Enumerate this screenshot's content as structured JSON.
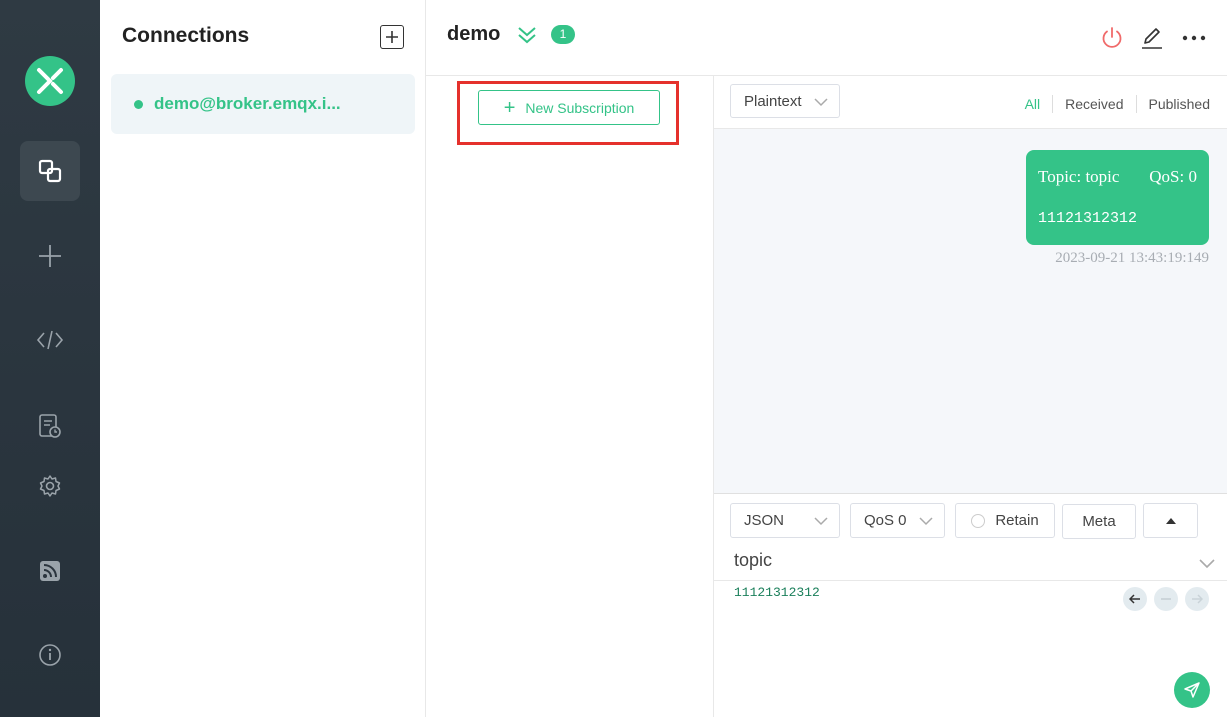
{
  "connections": {
    "title": "Connections",
    "items": [
      {
        "name": "demo@broker.emqx.i..."
      }
    ]
  },
  "header": {
    "title": "demo",
    "badge": "1"
  },
  "subscriptions": {
    "new_button_label": "New Subscription"
  },
  "messages": {
    "format_select": "Plaintext",
    "filters": {
      "all": "All",
      "received": "Received",
      "published": "Published",
      "active": "All"
    },
    "items": [
      {
        "topic": "Topic: topic",
        "qos": "QoS: 0",
        "payload": "11121312312",
        "time": "2023-09-21 13:43:19:149"
      }
    ]
  },
  "publish": {
    "format": "JSON",
    "qos": "QoS 0",
    "retain_label": "Retain",
    "meta_label": "Meta",
    "topic": "topic",
    "payload": "11121312312"
  },
  "colors": {
    "accent": "#34c388",
    "nav_bg": "#2f3a43",
    "highlight": "#e5312c"
  }
}
